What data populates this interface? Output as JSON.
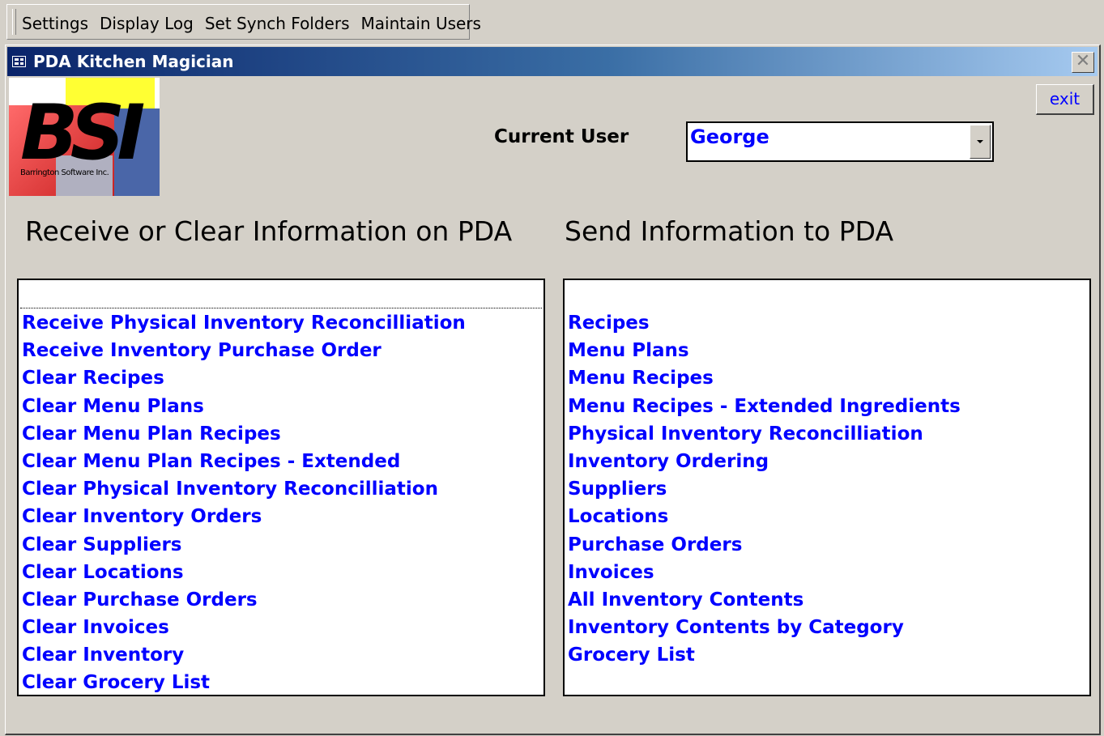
{
  "menubar": {
    "items": [
      "Settings",
      "Display Log",
      "Set Synch Folders",
      "Maintain Users"
    ]
  },
  "window": {
    "title": "PDA Kitchen Magician",
    "close_glyph": "✕"
  },
  "logo": {
    "letters": "BSI",
    "company": "Barrington Software Inc."
  },
  "exit_label": "exit",
  "current_user": {
    "label": "Current User",
    "value": "George"
  },
  "receive": {
    "heading": "Receive or Clear Information on PDA",
    "items": [
      "Receive Physical Inventory Reconcilliation",
      "Receive Inventory Purchase Order",
      "Clear Recipes",
      "Clear Menu Plans",
      "Clear Menu Plan Recipes",
      "Clear Menu Plan Recipes - Extended",
      "Clear Physical Inventory Reconcilliation",
      "Clear Inventory Orders",
      "Clear Suppliers",
      "Clear Locations",
      "Clear Purchase Orders",
      "Clear Invoices",
      "Clear Inventory",
      "Clear Grocery List"
    ]
  },
  "send": {
    "heading": "Send Information to PDA",
    "items": [
      "Recipes",
      "Menu Plans",
      "Menu Recipes",
      "Menu Recipes - Extended Ingredients",
      "Physical Inventory Reconcilliation",
      "Inventory Ordering",
      "Suppliers",
      "Locations",
      "Purchase Orders",
      "Invoices",
      "All Inventory Contents",
      "Inventory Contents by Category",
      "Grocery List"
    ]
  }
}
